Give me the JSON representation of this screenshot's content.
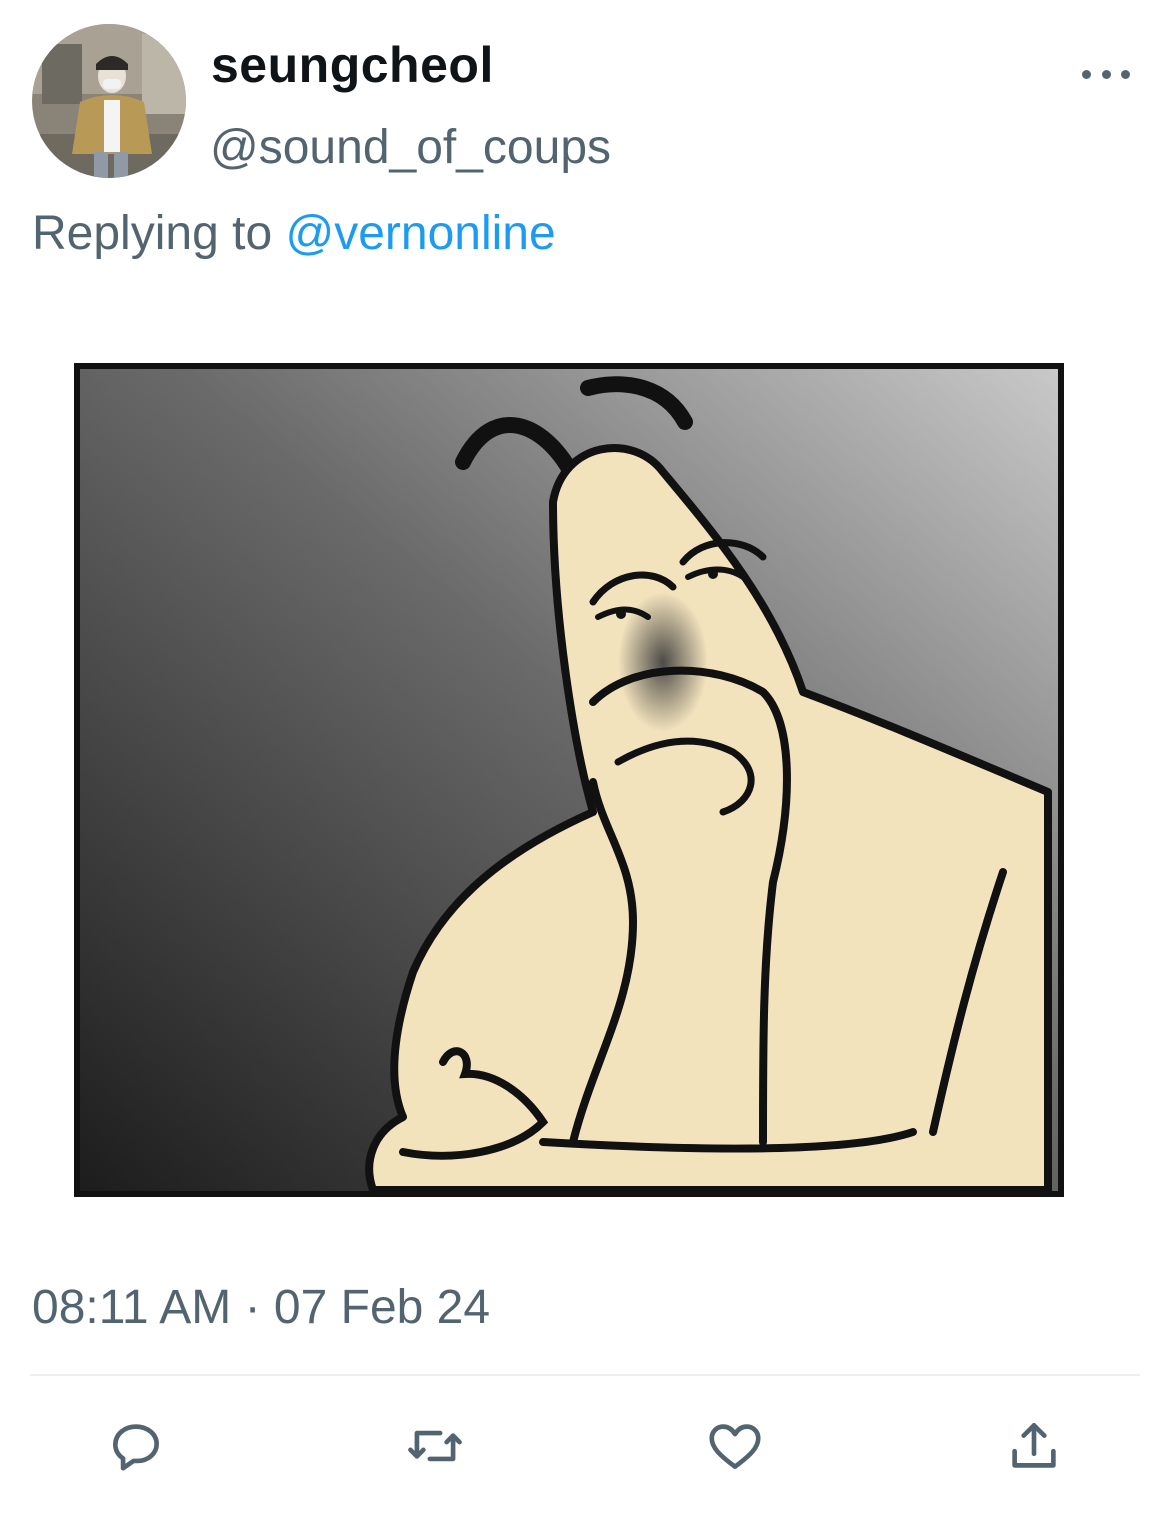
{
  "tweet": {
    "author": {
      "display_name": "seungcheol",
      "handle": "@sound_of_coups"
    },
    "reply": {
      "prefix": "Replying to",
      "mention": "@vernonline"
    },
    "timestamp": "08:11 AM · 07 Feb 24"
  },
  "actions": [
    {
      "icon": "reply-icon"
    },
    {
      "icon": "retweet-icon"
    },
    {
      "icon": "like-icon"
    },
    {
      "icon": "share-icon"
    }
  ],
  "colors": {
    "text_primary": "#0f1419",
    "text_secondary": "#536471",
    "link": "#1d9bf0",
    "icon": "#536471"
  }
}
